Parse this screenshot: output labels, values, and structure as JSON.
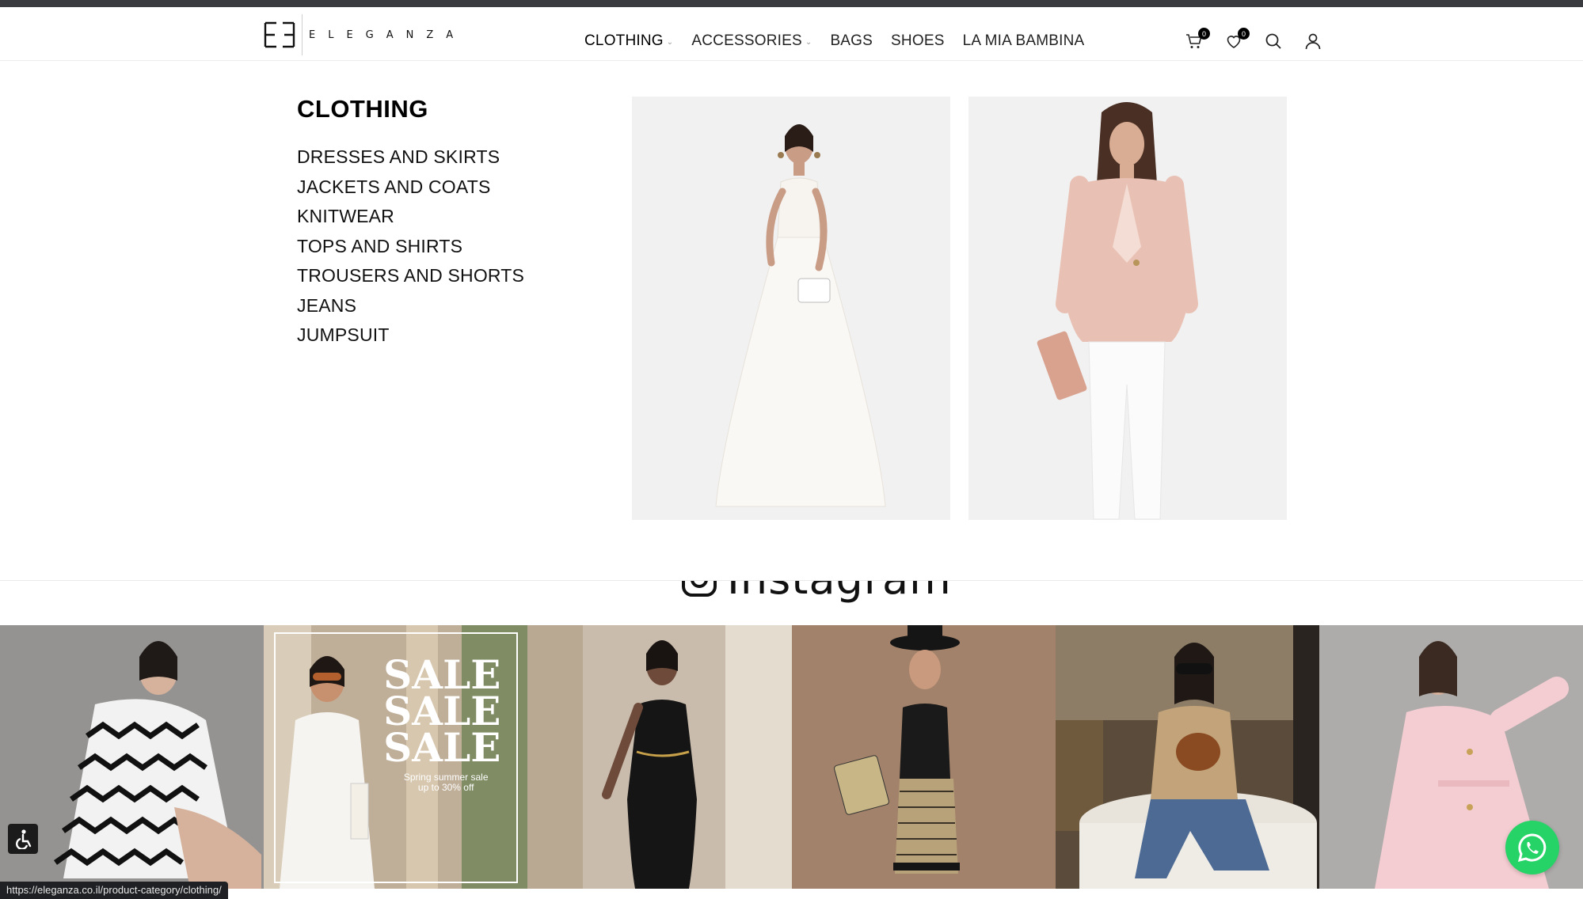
{
  "header": {
    "logo_text": "ELEGANZA",
    "nav": [
      {
        "label": "CLOTHING",
        "has_dropdown": true
      },
      {
        "label": "ACCESSORIES",
        "has_dropdown": true
      },
      {
        "label": "BAGS",
        "has_dropdown": false
      },
      {
        "label": "SHOES",
        "has_dropdown": false
      },
      {
        "label": "LA MIA BAMBINA",
        "has_dropdown": false
      }
    ],
    "cart_count": "0",
    "wishlist_count": "0",
    "icons": [
      "cart-icon",
      "heart-icon",
      "search-icon",
      "user-icon"
    ]
  },
  "mega_menu": {
    "title": "CLOTHING",
    "items": [
      "DRESSES AND SKIRTS",
      "JACKETS AND COATS",
      "KNITWEAR",
      "TOPS AND SHIRTS",
      "TROUSERS AND SHORTS",
      "JEANS",
      "JUMPSUIT"
    ]
  },
  "instagram": {
    "heading": "Instagram",
    "sale_banner": {
      "line1": "SALE",
      "line2": "SALE",
      "line3": "SALE",
      "sub1": "Spring summer sale",
      "sub2": "up to 30% off"
    }
  },
  "status_bar": {
    "url": "https://eleganza.co.il/product-category/clothing/"
  },
  "colors": {
    "whatsapp": "#25d366",
    "top_strip": "#3a3b3e"
  }
}
